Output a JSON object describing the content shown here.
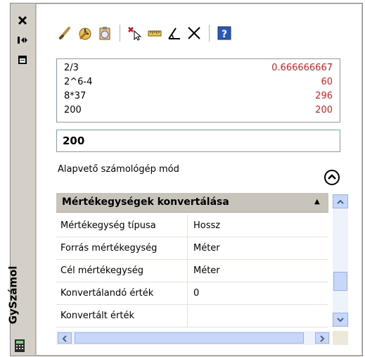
{
  "window": {
    "title": "GySzámol"
  },
  "toolbar": {
    "tools": [
      "clear-icon",
      "clear-history-icon",
      "paste-icon",
      "get-coordinates-icon",
      "distance-icon",
      "angle-icon",
      "intersection-icon",
      "help-icon"
    ]
  },
  "history": [
    {
      "expr": "2/3",
      "result": "0.666666667"
    },
    {
      "expr": "2^6-4",
      "result": "60"
    },
    {
      "expr": "8*37",
      "result": "296"
    },
    {
      "expr": "200",
      "result": "200"
    }
  ],
  "input": {
    "value": "200"
  },
  "mode": {
    "label": "Alapvető számológép mód"
  },
  "units": {
    "header": "Mértékegységek konvertálása",
    "rows": [
      {
        "label": "Mértékegység típusa",
        "value": "Hossz"
      },
      {
        "label": "Forrás mértékegység",
        "value": "Méter"
      },
      {
        "label": "Cél mértékegység",
        "value": "Méter"
      },
      {
        "label": "Konvertálandó érték",
        "value": "0"
      },
      {
        "label": "Konvertált érték",
        "value": ""
      }
    ]
  },
  "colors": {
    "result": "#e02020",
    "scroll": "#c7d7f7",
    "panel": "#d4d0c8"
  }
}
